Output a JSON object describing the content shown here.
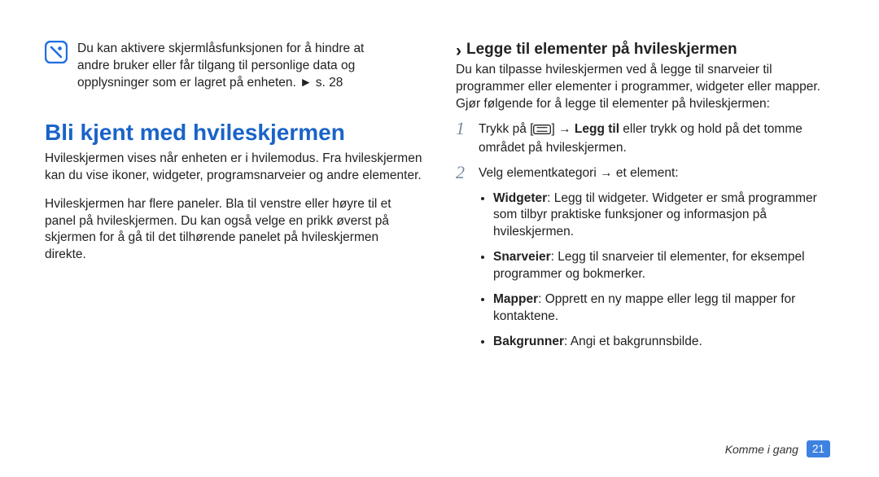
{
  "left": {
    "note": {
      "l1": "Du kan aktivere skjermlåsfunksjonen for å hindre at",
      "l2": "andre bruker eller får tilgang til personlige data og",
      "l3_pre": "opplysninger som er lagret på enheten. ",
      "l3_arrow": "►",
      "l3_post": " s. 28"
    },
    "h1": "Bli kjent med hvileskjermen",
    "p1": "Hvileskjermen vises når enheten er i hvilemodus. Fra hvileskjermen kan du vise ikoner, widgeter, programsnarveier og andre elementer.",
    "p2": "Hvileskjermen har flere paneler. Bla til venstre eller høyre til et panel på hvileskjermen. Du kan også velge en prikk øverst på skjermen for å gå til det tilhørende panelet på hvileskjermen direkte."
  },
  "right": {
    "h2_chev": "›",
    "h2": "Legge til elementer på hvileskjermen",
    "intro": "Du kan tilpasse hvileskjermen ved å legge til snarveier til programmer eller elementer i programmer, widgeter eller mapper. Gjør følgende for å legge til elementer på hvileskjermen:",
    "step1": {
      "num": "1",
      "pre1": "Trykk på [",
      "icon_name": "menu-key-icon",
      "post1": "] → ",
      "bold": "Legg til",
      "post2": " eller trykk og hold på det tomme området på hvileskjermen."
    },
    "step2": {
      "num": "2",
      "text": "Velg elementkategori → et element:"
    },
    "bullets": {
      "widgeter_b": "Widgeter",
      "widgeter_t": ": Legg til widgeter. Widgeter er små programmer som tilbyr praktiske funksjoner og informasjon på hvileskjermen.",
      "snarveier_b": "Snarveier",
      "snarveier_t": ": Legg til snarveier til elementer, for eksempel programmer og bokmerker.",
      "mapper_b": "Mapper",
      "mapper_t": ": Opprett en ny mappe eller legg til mapper for kontaktene.",
      "bakgr_b": "Bakgrunner",
      "bakgr_t": ": Angi et bakgrunnsbilde."
    }
  },
  "footer": {
    "section": "Komme i gang",
    "page": "21"
  }
}
